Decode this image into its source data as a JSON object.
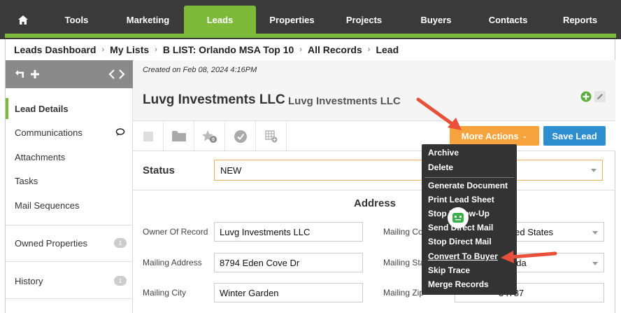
{
  "nav": {
    "home_icon": "home-icon",
    "items": [
      {
        "label": "Tools",
        "active": false
      },
      {
        "label": "Marketing",
        "active": false
      },
      {
        "label": "Leads",
        "active": true
      },
      {
        "label": "Properties",
        "active": false
      },
      {
        "label": "Projects",
        "active": false
      },
      {
        "label": "Buyers",
        "active": false
      },
      {
        "label": "Contacts",
        "active": false
      },
      {
        "label": "Reports",
        "active": false
      }
    ],
    "colors": {
      "bar": "#3a3a3a",
      "accent": "#7dba3a"
    }
  },
  "breadcrumb": [
    "Leads Dashboard",
    "My Lists",
    "B LIST: Orlando MSA Top 10",
    "All Records",
    "Lead"
  ],
  "sidebar": {
    "items": [
      {
        "label": "Lead Details",
        "active": true
      },
      {
        "label": "Communications",
        "icon": "speech-bubble-icon"
      },
      {
        "label": "Attachments"
      },
      {
        "label": "Tasks"
      },
      {
        "label": "Mail Sequences"
      },
      {
        "label": "Owned Properties",
        "badge": "1"
      },
      {
        "label": "History",
        "badge": "1"
      }
    ]
  },
  "lead": {
    "created": "Created on Feb 08, 2024 4:16PM",
    "title": "Luvg Investments LLC",
    "subtitle": "Luvg Investments LLC"
  },
  "toolbar": {
    "star_count": "0",
    "more_actions_label": "More Actions",
    "save_label": "Save Lead",
    "colors": {
      "more": "#f7a33d",
      "save": "#2d8fd0"
    }
  },
  "status": {
    "label": "Status",
    "value": "NEW"
  },
  "address": {
    "title": "Address",
    "owner_of_record": {
      "label": "Owner Of Record",
      "value": "Luvg Investments LLC"
    },
    "mailing_address": {
      "label": "Mailing Address",
      "value": "8794 Eden Cove Dr"
    },
    "mailing_city": {
      "label": "Mailing City",
      "value": "Winter Garden"
    },
    "mailing_country": {
      "label": "Mailing Cou",
      "value": "United States"
    },
    "mailing_state": {
      "label": "Mailing Stat",
      "value": "Florida"
    },
    "mailing_zip": {
      "label": "Mailing Zip",
      "value": "34787"
    }
  },
  "more_actions_menu": {
    "group1": [
      "Archive",
      "Delete"
    ],
    "group2": [
      "Generate Document",
      "Print Lead Sheet",
      "Stop Follow-Up",
      "Send Direct Mail",
      "Stop Direct Mail",
      "Convert To Buyer",
      "Skip Trace",
      "Merge Records"
    ]
  }
}
